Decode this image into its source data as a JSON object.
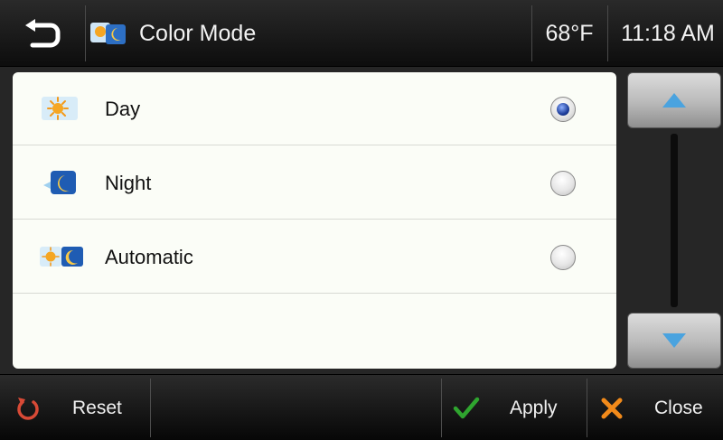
{
  "header": {
    "back_icon": "back-arrow-icon",
    "title_icon": "color-mode-icon",
    "title": "Color Mode",
    "temperature": "68°F",
    "time": "11:18 AM"
  },
  "options": [
    {
      "label": "Day",
      "icon": "sun-icon",
      "selected": true
    },
    {
      "label": "Night",
      "icon": "moon-icon",
      "selected": false
    },
    {
      "label": "Automatic",
      "icon": "sun-moon-icon",
      "selected": false
    }
  ],
  "scroll": {
    "up_icon": "arrow-up-icon",
    "down_icon": "arrow-down-icon"
  },
  "footer": {
    "reset_label": "Reset",
    "apply_label": "Apply",
    "close_label": "Close"
  },
  "colors": {
    "accent_blue": "#4aa3df",
    "apply_green": "#2fa52f",
    "close_orange": "#f28a1a",
    "reset_red": "#d84a36"
  }
}
